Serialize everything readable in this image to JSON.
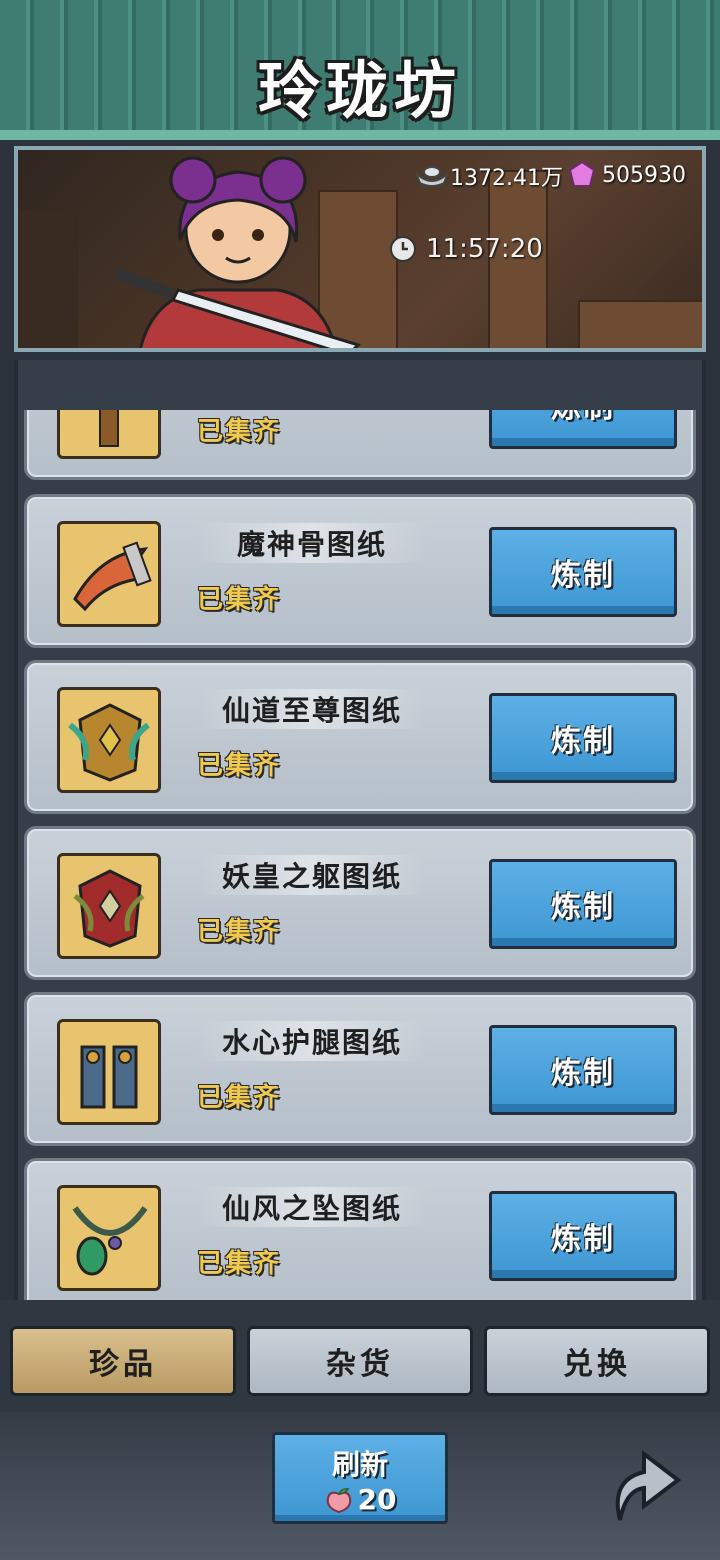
{
  "header": {
    "title": "玲珑坊"
  },
  "banner": {
    "silver": "1372.41万",
    "gems": "505930",
    "timer": "11:57:20"
  },
  "items": [
    {
      "name": "",
      "status": "已集齐",
      "button": "炼制",
      "icon": "scroll-hammer-icon"
    },
    {
      "name": "魔神骨图纸",
      "status": "已集齐",
      "button": "炼制",
      "icon": "horn-bone-icon"
    },
    {
      "name": "仙道至尊图纸",
      "status": "已集齐",
      "button": "炼制",
      "icon": "green-armor-icon"
    },
    {
      "name": "妖皇之躯图纸",
      "status": "已集齐",
      "button": "炼制",
      "icon": "red-armor-icon"
    },
    {
      "name": "水心护腿图纸",
      "status": "已集齐",
      "button": "炼制",
      "icon": "leg-guard-icon"
    },
    {
      "name": "仙风之坠图纸",
      "status": "已集齐",
      "button": "炼制",
      "icon": "jade-pendant-icon"
    }
  ],
  "tabs": [
    {
      "label": "珍品",
      "active": true
    },
    {
      "label": "杂货",
      "active": false
    },
    {
      "label": "兑换",
      "active": false
    }
  ],
  "refresh": {
    "label": "刷新",
    "cost": "20"
  },
  "colors": {
    "accent_blue": "#3d96d2",
    "status_gold": "#f0c94f",
    "awning_green": "#3f7d72",
    "tab_active": "#d9c08c"
  }
}
